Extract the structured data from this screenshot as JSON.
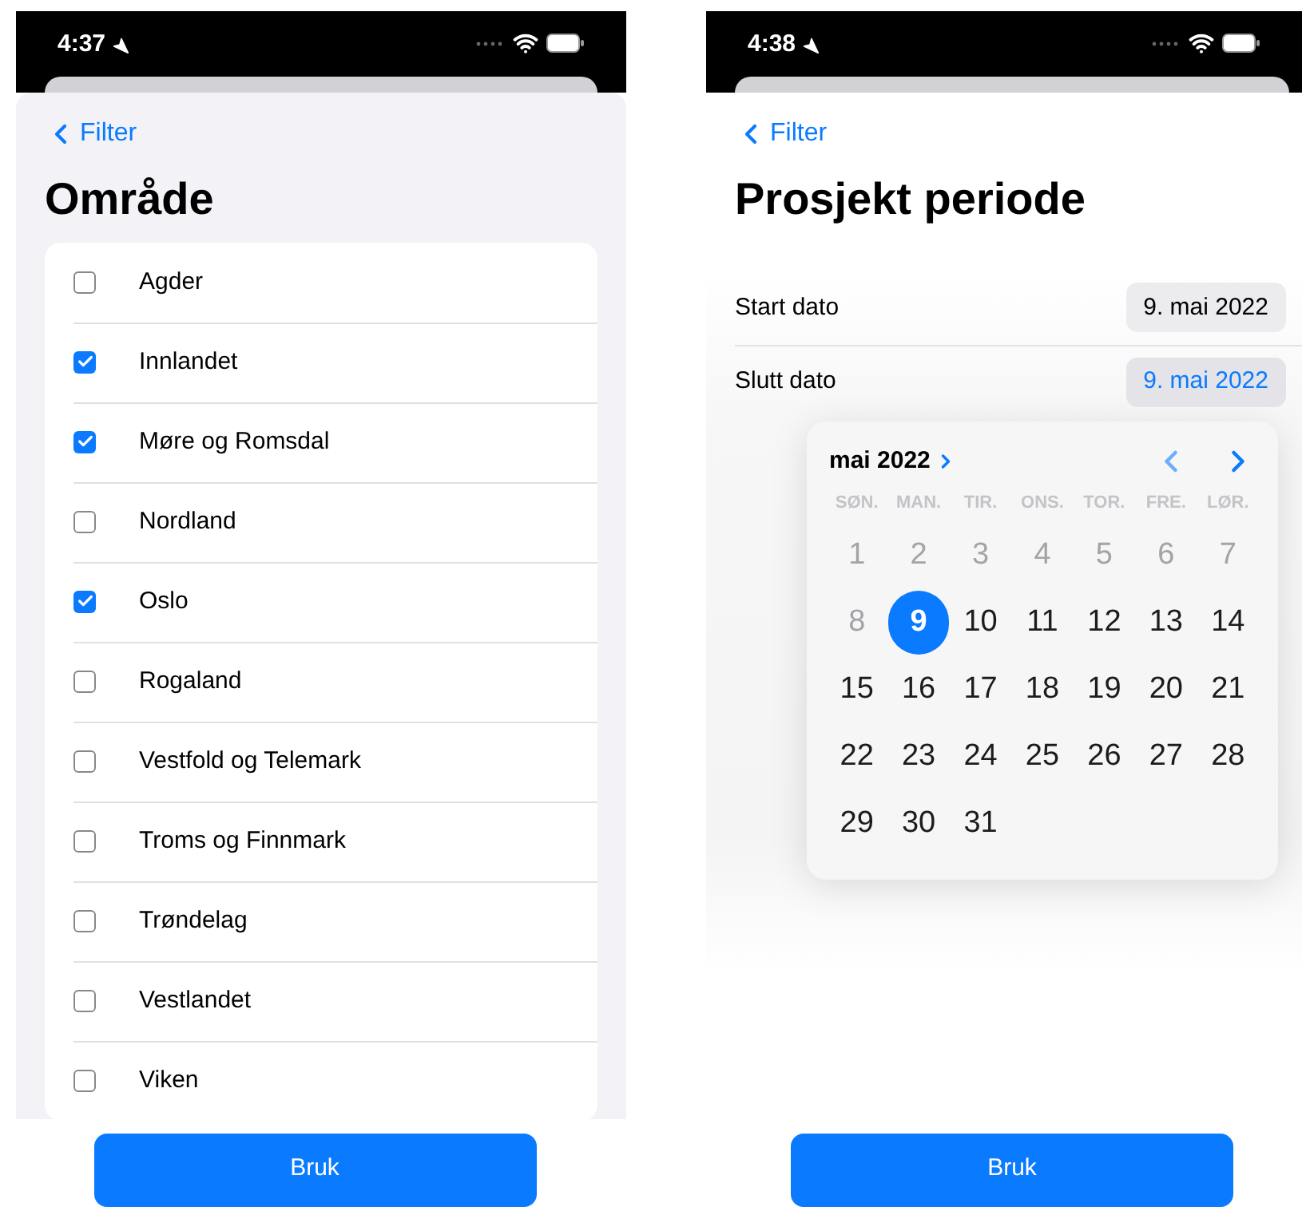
{
  "left_screen": {
    "status_bar": {
      "time": "4:37"
    },
    "back": "Filter",
    "title": "Område",
    "regions": [
      {
        "label": "Agder",
        "checked": false
      },
      {
        "label": "Innlandet",
        "checked": true
      },
      {
        "label": "Møre og Romsdal",
        "checked": true
      },
      {
        "label": "Nordland",
        "checked": false
      },
      {
        "label": "Oslo",
        "checked": true
      },
      {
        "label": "Rogaland",
        "checked": false
      },
      {
        "label": "Vestfold og Telemark",
        "checked": false
      },
      {
        "label": "Troms og Finnmark",
        "checked": false
      },
      {
        "label": "Trøndelag",
        "checked": false
      },
      {
        "label": "Vestlandet",
        "checked": false
      },
      {
        "label": "Viken",
        "checked": false
      }
    ],
    "button": "Bruk"
  },
  "right_screen": {
    "status_bar": {
      "time": "4:38"
    },
    "back": "Filter",
    "title": "Prosjekt periode",
    "date_rows": [
      {
        "label": "Start dato",
        "value": "9. mai 2022",
        "selected": false
      },
      {
        "label": "Slutt dato",
        "value": "9. mai 2022",
        "selected": true
      }
    ],
    "calendar": {
      "month": "mai 2022",
      "weekdays": [
        "SØN.",
        "MAN.",
        "TIR.",
        "ONS.",
        "TOR.",
        "FRE.",
        "LØR."
      ],
      "days": [
        {
          "label": "1",
          "disabled": true,
          "selected": false
        },
        {
          "label": "2",
          "disabled": true,
          "selected": false
        },
        {
          "label": "3",
          "disabled": true,
          "selected": false
        },
        {
          "label": "4",
          "disabled": true,
          "selected": false
        },
        {
          "label": "5",
          "disabled": true,
          "selected": false
        },
        {
          "label": "6",
          "disabled": true,
          "selected": false
        },
        {
          "label": "7",
          "disabled": true,
          "selected": false
        },
        {
          "label": "8",
          "disabled": true,
          "selected": false
        },
        {
          "label": "9",
          "disabled": false,
          "selected": true
        },
        {
          "label": "10",
          "disabled": false,
          "selected": false
        },
        {
          "label": "11",
          "disabled": false,
          "selected": false
        },
        {
          "label": "12",
          "disabled": false,
          "selected": false
        },
        {
          "label": "13",
          "disabled": false,
          "selected": false
        },
        {
          "label": "14",
          "disabled": false,
          "selected": false
        },
        {
          "label": "15",
          "disabled": false,
          "selected": false
        },
        {
          "label": "16",
          "disabled": false,
          "selected": false
        },
        {
          "label": "17",
          "disabled": false,
          "selected": false
        },
        {
          "label": "18",
          "disabled": false,
          "selected": false
        },
        {
          "label": "19",
          "disabled": false,
          "selected": false
        },
        {
          "label": "20",
          "disabled": false,
          "selected": false
        },
        {
          "label": "21",
          "disabled": false,
          "selected": false
        },
        {
          "label": "22",
          "disabled": false,
          "selected": false
        },
        {
          "label": "23",
          "disabled": false,
          "selected": false
        },
        {
          "label": "24",
          "disabled": false,
          "selected": false
        },
        {
          "label": "25",
          "disabled": false,
          "selected": false
        },
        {
          "label": "26",
          "disabled": false,
          "selected": false
        },
        {
          "label": "27",
          "disabled": false,
          "selected": false
        },
        {
          "label": "28",
          "disabled": false,
          "selected": false
        },
        {
          "label": "29",
          "disabled": false,
          "selected": false
        },
        {
          "label": "30",
          "disabled": false,
          "selected": false
        },
        {
          "label": "31",
          "disabled": false,
          "selected": false
        }
      ]
    },
    "button": "Bruk"
  }
}
